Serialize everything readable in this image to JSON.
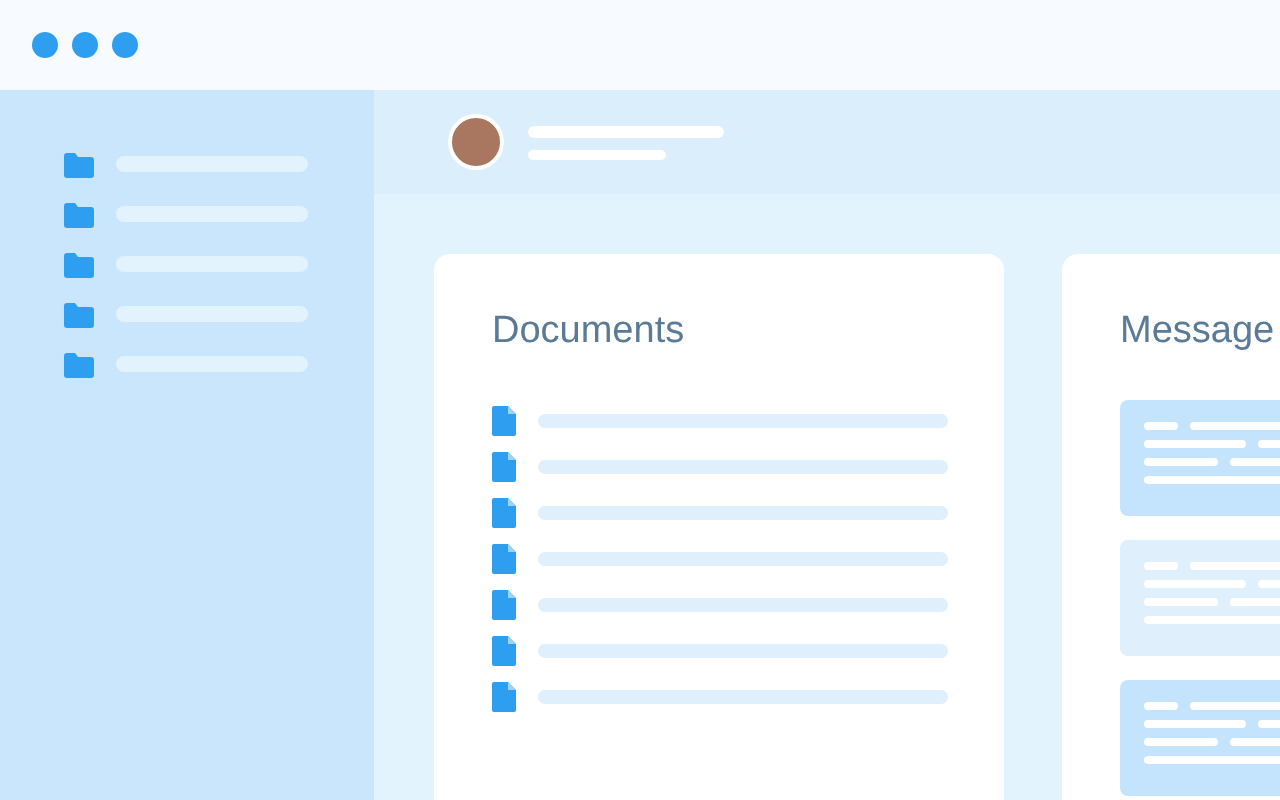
{
  "window": {
    "controls": [
      {
        "kind": "dot"
      },
      {
        "kind": "dot"
      },
      {
        "kind": "dot"
      }
    ]
  },
  "sidebar": {
    "items": [
      {
        "kind": "folder"
      },
      {
        "kind": "folder"
      },
      {
        "kind": "folder"
      },
      {
        "kind": "folder"
      },
      {
        "kind": "folder"
      }
    ]
  },
  "header": {
    "avatar": {
      "kind": "photo"
    }
  },
  "documents": {
    "title": "Documents",
    "items": [
      {
        "kind": "file"
      },
      {
        "kind": "file"
      },
      {
        "kind": "file"
      },
      {
        "kind": "file"
      },
      {
        "kind": "file"
      },
      {
        "kind": "file"
      },
      {
        "kind": "file"
      }
    ]
  },
  "messages": {
    "title": "Message",
    "items": [
      {
        "highlighted": true
      },
      {
        "highlighted": false
      },
      {
        "highlighted": true
      }
    ]
  }
}
